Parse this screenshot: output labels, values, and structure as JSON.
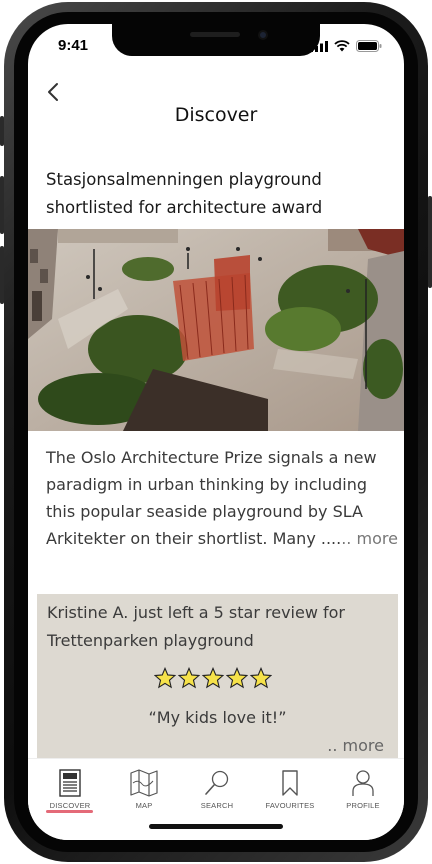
{
  "status_bar": {
    "time": "9:41"
  },
  "header": {
    "title": "Discover"
  },
  "article": {
    "title": "Stasjonsalmenningen playground shortlisted for architecture award",
    "excerpt": "The Oslo Architecture Prize signals a new paradigm in urban thinking by including this popular seaside playground by SLA Arkitekter on their shortlist. Many ....",
    "more_label": ".. more"
  },
  "review": {
    "text": "Kristine A. just left a 5 star review for Trettenparken playground",
    "rating": 5,
    "quote": "“My kids love it!”",
    "more_label": ".. more"
  },
  "tabbar": {
    "items": [
      {
        "label": "DISCOVER",
        "icon": "discover-icon",
        "active": true
      },
      {
        "label": "MAP",
        "icon": "map-icon",
        "active": false
      },
      {
        "label": "SEARCH",
        "icon": "search-icon",
        "active": false
      },
      {
        "label": "FAVOURITES",
        "icon": "bookmark-icon",
        "active": false
      },
      {
        "label": "PROFILE",
        "icon": "profile-icon",
        "active": false
      }
    ],
    "accent_color": "#e46a78"
  },
  "colors": {
    "review_card_bg": "#ddd9d1",
    "star_fill": "#f6e24a"
  }
}
